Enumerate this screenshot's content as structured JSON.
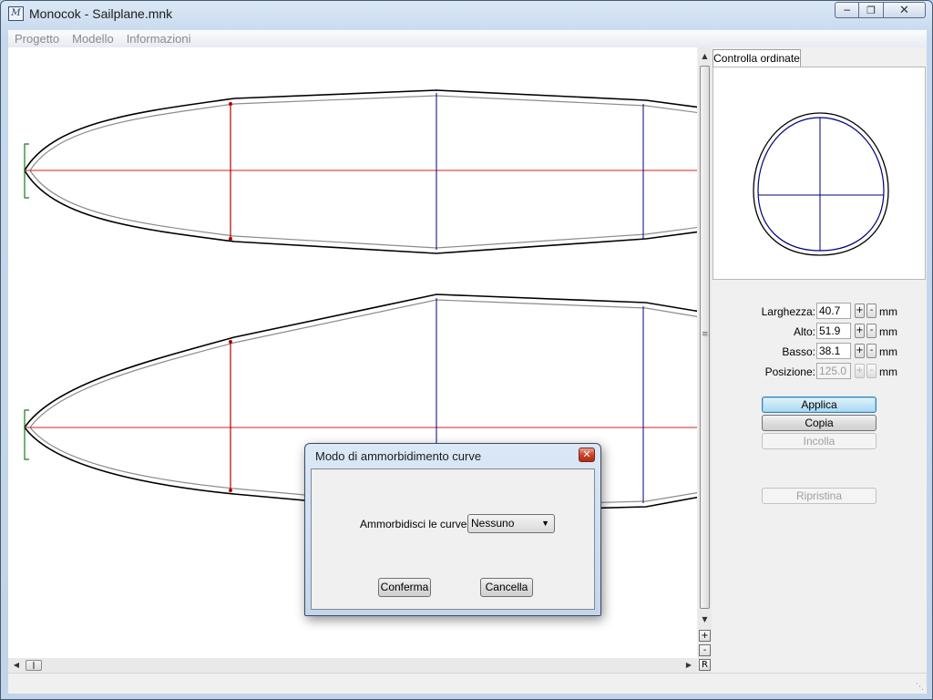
{
  "window": {
    "title": "Monocok - Sailplane.mnk",
    "icon": "app-monocok-icon",
    "controls": [
      "minimize-icon",
      "maximize-icon",
      "close-icon"
    ]
  },
  "menu": {
    "items": [
      {
        "label": "Progetto"
      },
      {
        "label": "Modello"
      },
      {
        "label": "Informazioni"
      }
    ]
  },
  "canvas": {
    "colors": {
      "outline": "#000000",
      "inner_outline": "#8c8c8c",
      "axis": "#d62020",
      "former_red": "#b00000",
      "former_blue": "#00007f",
      "nose": "#1a7a1a"
    }
  },
  "zoom": {
    "plus": "+",
    "minus": "-",
    "reset": "R"
  },
  "panel": {
    "tab_label": "Controlla ordinate",
    "fields": [
      {
        "label": "Larghezza:",
        "value": "40.7",
        "unit": "mm",
        "enabled": true
      },
      {
        "label": "Alto:",
        "value": "51.9",
        "unit": "mm",
        "enabled": true
      },
      {
        "label": "Basso:",
        "value": "38.1",
        "unit": "mm",
        "enabled": true
      },
      {
        "label": "Posizione:",
        "value": "125.0",
        "unit": "mm",
        "enabled": false
      }
    ],
    "spin_plus": "+",
    "spin_minus": "-",
    "buttons": {
      "apply": "Applica",
      "copy": "Copia",
      "paste": "Incolla",
      "restore": "Ripristina"
    }
  },
  "dialog": {
    "title": "Modo di ammorbidimento curve",
    "label": "Ammorbidisci le curve :",
    "select_value": "Nessuno",
    "confirm": "Conferma",
    "cancel": "Cancella"
  }
}
